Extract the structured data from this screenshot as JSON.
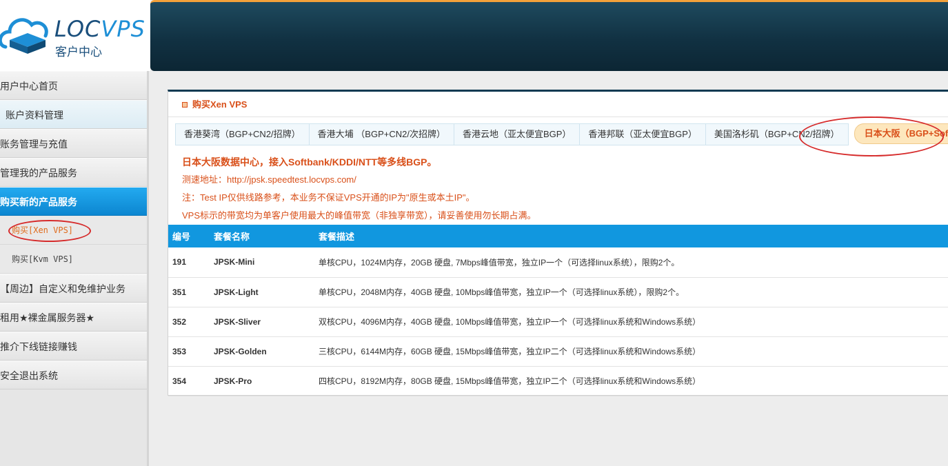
{
  "brand": {
    "name_part1": "LOC",
    "name_part2": "VPS",
    "subtitle": "客户中心"
  },
  "sidebar": {
    "items": [
      {
        "label": "用户中心首页"
      },
      {
        "label": "账户资料管理"
      },
      {
        "label": "账务管理与充值"
      },
      {
        "label": "管理我的产品服务"
      },
      {
        "label": "购买新的产品服务"
      }
    ],
    "sub_items": [
      {
        "label": "购买[Xen VPS]"
      },
      {
        "label": "购买[Kvm VPS]"
      }
    ],
    "more_items": [
      {
        "label": "【周边】自定义和免维护业务"
      },
      {
        "label": "租用★裸金属服务器★"
      },
      {
        "label": "推介下线链接赚钱"
      },
      {
        "label": "安全退出系统"
      }
    ]
  },
  "panel": {
    "title": "购买Xen VPS",
    "tabs": [
      {
        "label": "香港葵湾（BGP+CN2/招牌）"
      },
      {
        "label": "香港大埔 （BGP+CN2/次招牌）"
      },
      {
        "label": "香港云地（亚太便宜BGP）"
      },
      {
        "label": "香港邦联（亚太便宜BGP）"
      },
      {
        "label": "美国洛杉矶（BGP+CN2/招牌）"
      },
      {
        "label": "日本大阪（BGP+SoftBank）"
      }
    ],
    "notes": {
      "headline": "日本大阪数据中心，接入Softbank/KDDI/NTT等多线BGP。",
      "speedtest": "测速地址：http://jpsk.speedtest.locvps.com/",
      "test_ip_note": "注：Test IP仅供线路参考，本业务不保证VPS开通的IP为\"原生或本土IP\"。",
      "bandwidth_note": "VPS标示的带宽均为单客户使用最大的峰值带宽（非独享带宽），请妥善使用勿长期占满。"
    },
    "table": {
      "headers": {
        "id": "编号",
        "name": "套餐名称",
        "desc": "套餐描述"
      },
      "rows": [
        {
          "id": "191",
          "name": "JPSK-Mini",
          "desc": "单核CPU，1024M内存，20GB 硬盘, 7Mbps峰值带宽，独立IP一个（可选择linux系统），限购2个。"
        },
        {
          "id": "351",
          "name": "JPSK-Light",
          "desc": "单核CPU，2048M内存，40GB 硬盘, 10Mbps峰值带宽，独立IP一个（可选择linux系统），限购2个。"
        },
        {
          "id": "352",
          "name": "JPSK-Sliver",
          "desc": "双核CPU，4096M内存，40GB 硬盘, 10Mbps峰值带宽，独立IP一个（可选择linux系统和Windows系统）"
        },
        {
          "id": "353",
          "name": "JPSK-Golden",
          "desc": "三核CPU，6144M内存，60GB 硬盘, 15Mbps峰值带宽，独立IP二个（可选择linux系统和Windows系统）"
        },
        {
          "id": "354",
          "name": "JPSK-Pro",
          "desc": "四核CPU，8192M内存，80GB 硬盘, 15Mbps峰值带宽，独立IP二个（可选择linux系统和Windows系统）"
        }
      ]
    }
  },
  "colors": {
    "accent_orange": "#d9501a",
    "header_blue": "#1197df",
    "top_bar": "#113142",
    "highlight_ring": "#d62b2b"
  }
}
